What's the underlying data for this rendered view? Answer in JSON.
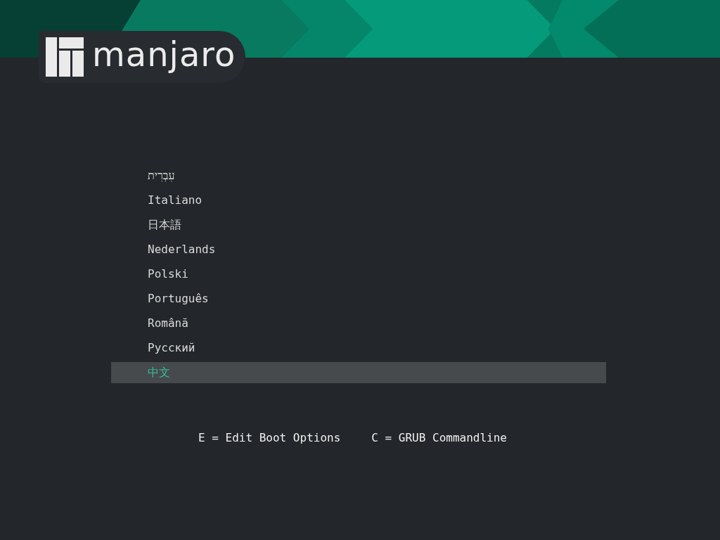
{
  "logo": {
    "text": "manjaro"
  },
  "menu": {
    "items": [
      {
        "label": "עִבְרִית",
        "selected": false
      },
      {
        "label": "Italiano",
        "selected": false
      },
      {
        "label": "日本語",
        "selected": false
      },
      {
        "label": "Nederlands",
        "selected": false
      },
      {
        "label": "Polski",
        "selected": false
      },
      {
        "label": "Português",
        "selected": false
      },
      {
        "label": "Română",
        "selected": false
      },
      {
        "label": "Русский",
        "selected": false
      },
      {
        "label": "中文",
        "selected": true
      }
    ]
  },
  "hints": [
    "E = Edit Boot Options",
    "C = GRUB Commandline"
  ]
}
